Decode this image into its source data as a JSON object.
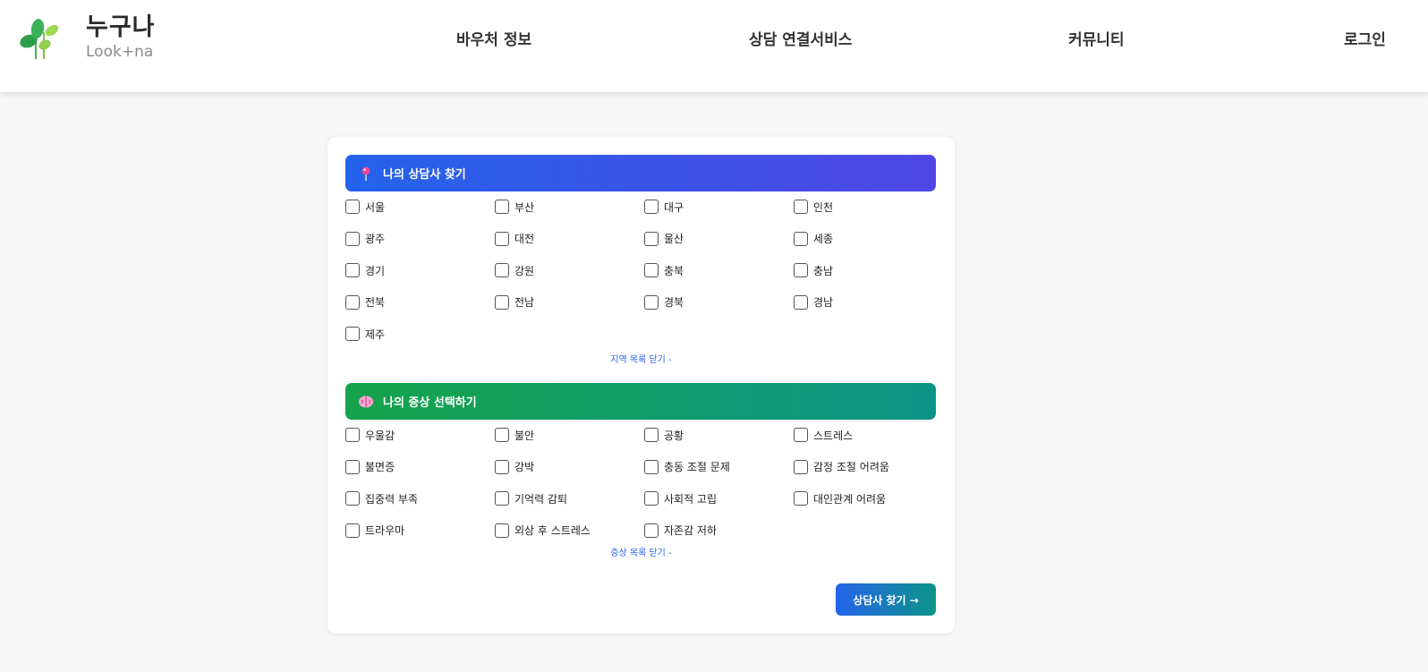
{
  "header": {
    "logo_title": "누구나",
    "logo_subtitle": "Look+na",
    "nav": [
      "바우처 정보",
      "상담 연결서비스",
      "커뮤니티",
      "로그인"
    ]
  },
  "region_section": {
    "title": "나의 상담사 찾기",
    "icon": "pin-icon",
    "options": [
      "서울",
      "부산",
      "대구",
      "인천",
      "광주",
      "대전",
      "울산",
      "세종",
      "경기",
      "강원",
      "충북",
      "충남",
      "전북",
      "전남",
      "경북",
      "경남",
      "제주"
    ],
    "toggle_label": "지역 목록 닫기 -"
  },
  "symptom_section": {
    "title": "나의 증상 선택하기",
    "icon": "brain-icon",
    "options": [
      "우울감",
      "불안",
      "공황",
      "스트레스",
      "불면증",
      "강박",
      "충동 조절 문제",
      "감정 조절 어려움",
      "집중력 부족",
      "기억력 감퇴",
      "사회적 고립",
      "대인관계 어려움",
      "트라우마",
      "외상 후 스트레스",
      "자존감 저하"
    ],
    "toggle_label": "증상 목록 닫기 -"
  },
  "submit_label": "상담사 찾기 →",
  "colors": {
    "region_gradient": [
      "#2463eb",
      "#4f46e5"
    ],
    "symptom_gradient": [
      "#16a34a",
      "#0d9488"
    ],
    "link": "#2563eb"
  }
}
